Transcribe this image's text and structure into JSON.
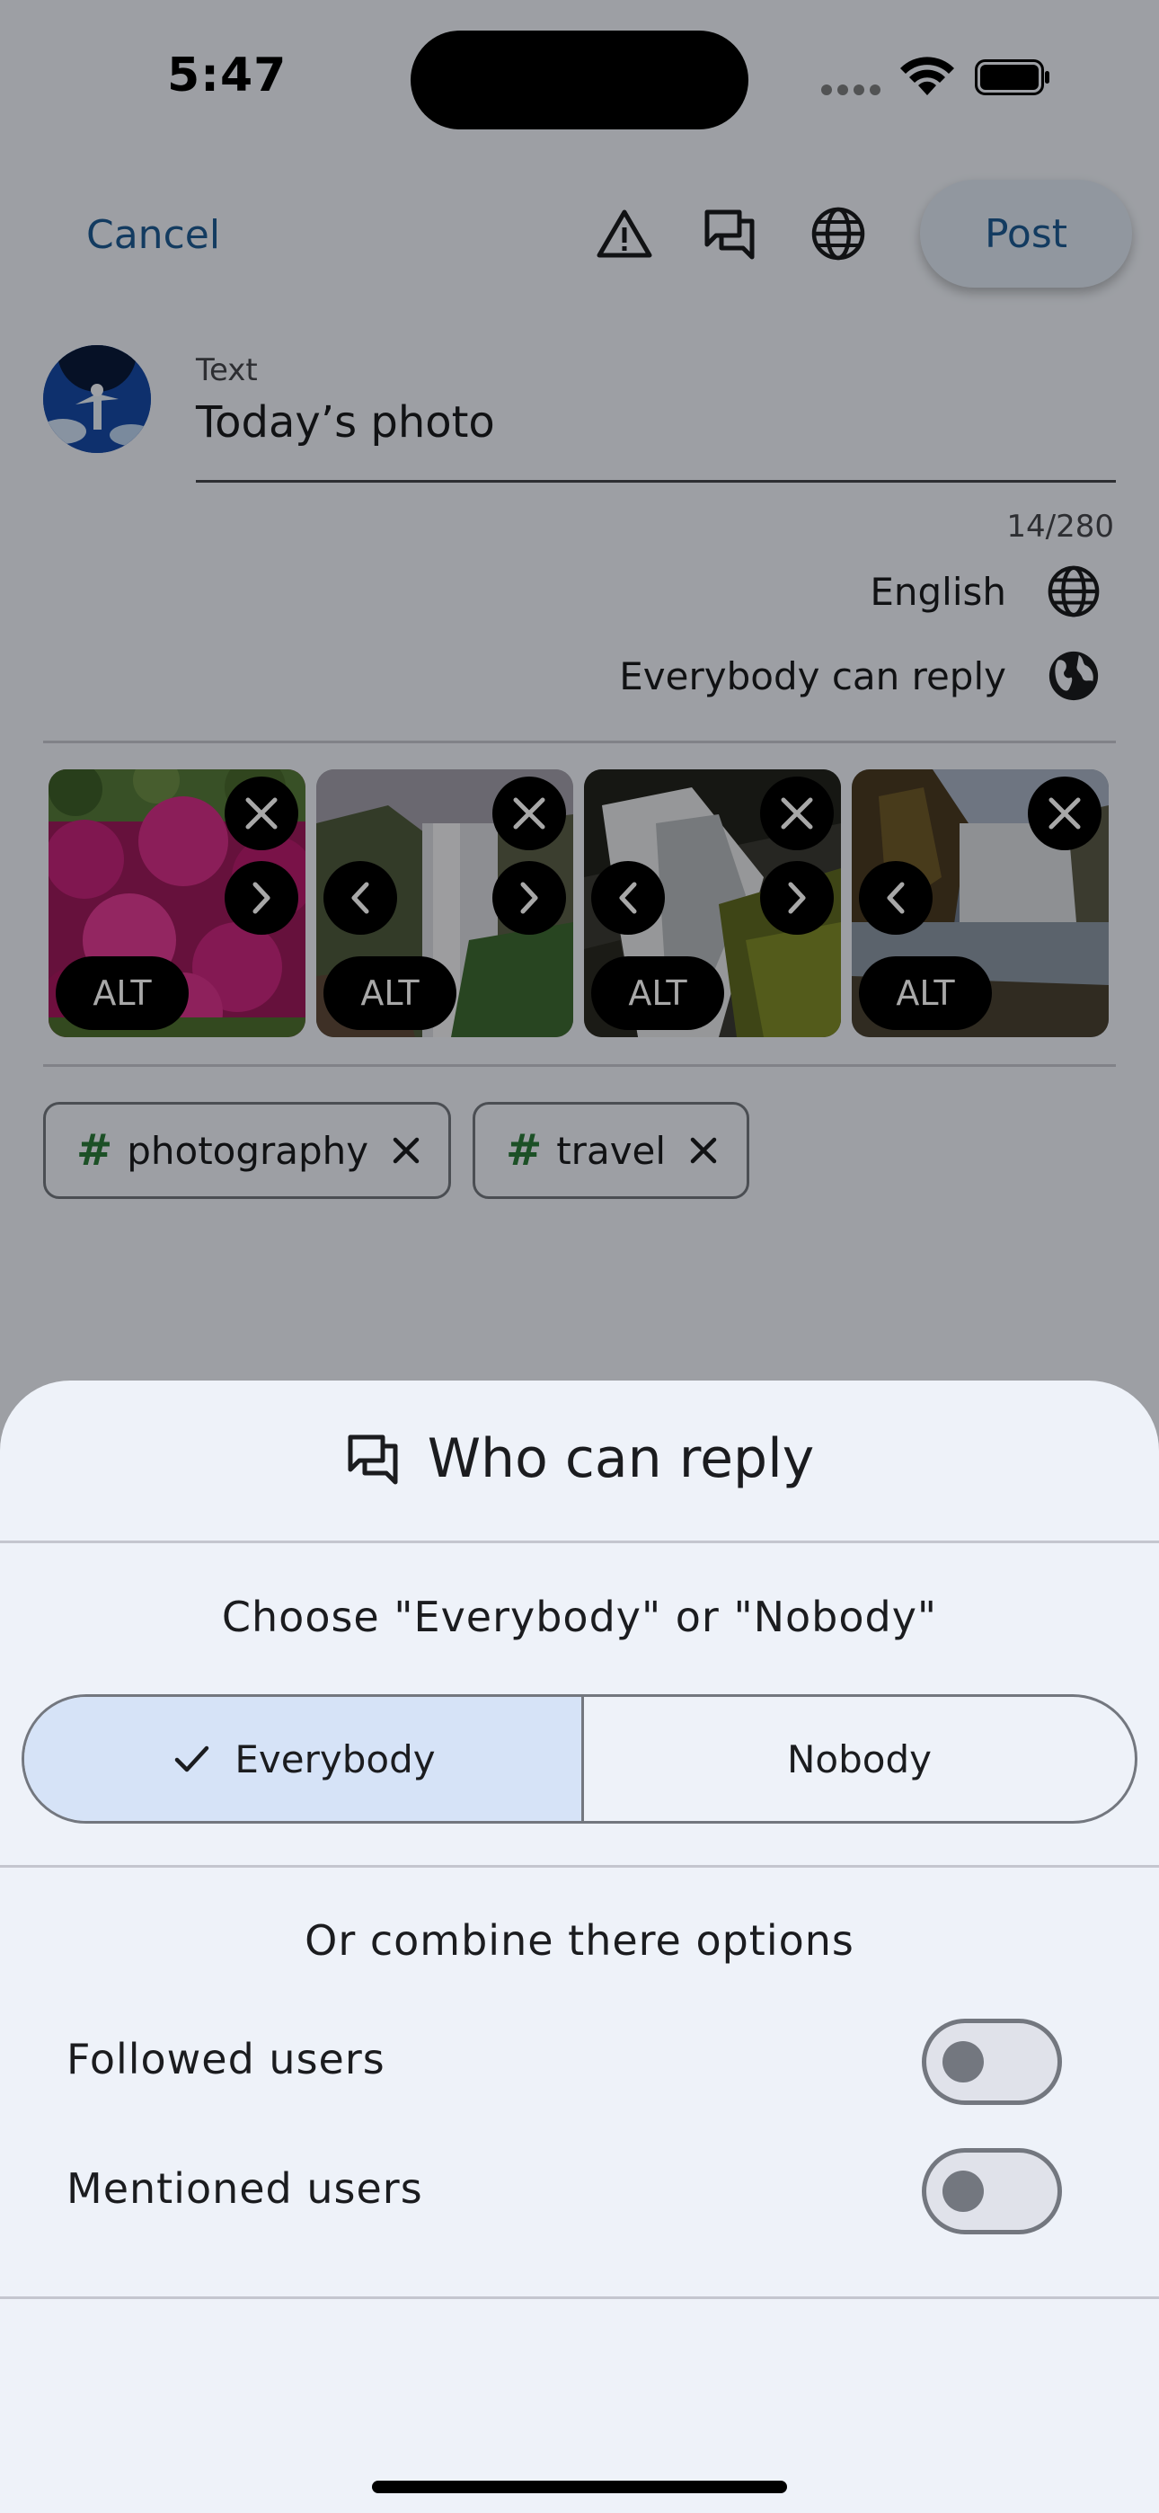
{
  "status_bar": {
    "time": "5:47"
  },
  "composer": {
    "cancel_label": "Cancel",
    "post_label": "Post",
    "toolbar_icons": [
      "warning-icon",
      "reply-settings-icon",
      "language-icon"
    ],
    "field_label": "Text",
    "field_value": "Today’s photo",
    "counter": "14/280",
    "language": "English",
    "reply_setting": "Everybody can reply"
  },
  "media": [
    {
      "alt_label": "ALT",
      "has_prev": false,
      "has_next": true
    },
    {
      "alt_label": "ALT",
      "has_prev": true,
      "has_next": true
    },
    {
      "alt_label": "ALT",
      "has_prev": true,
      "has_next": true
    },
    {
      "alt_label": "ALT",
      "has_prev": true,
      "has_next": false
    }
  ],
  "tags": [
    {
      "hash": "#",
      "text": "photography"
    },
    {
      "hash": "#",
      "text": "travel"
    }
  ],
  "sheet": {
    "title": "Who can reply",
    "choose_prompt": "Choose \"Everybody\" or \"Nobody\"",
    "segments": [
      {
        "label": "Everybody",
        "selected": true
      },
      {
        "label": "Nobody",
        "selected": false
      }
    ],
    "combine_prompt": "Or combine there options",
    "options": [
      {
        "label": "Followed users",
        "enabled": false
      },
      {
        "label": "Mentioned users",
        "enabled": false
      }
    ]
  },
  "colors": {
    "accent": "#1d5a92",
    "sheet_background": "#eef2f9",
    "selected_segment": "#d6e3f7",
    "outline": "#73777f",
    "tag_hash": "#2b7a3b"
  }
}
